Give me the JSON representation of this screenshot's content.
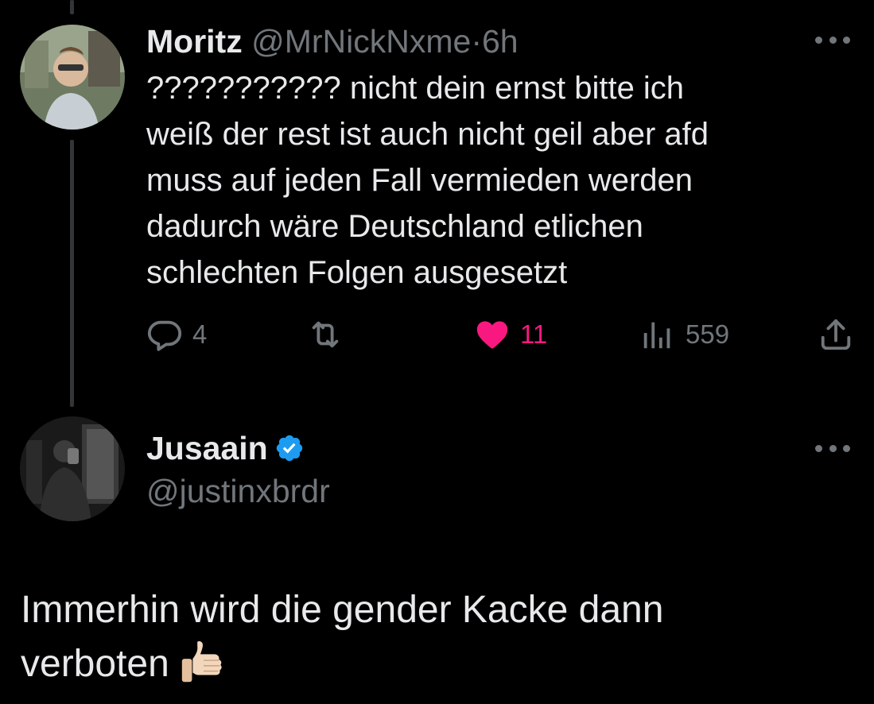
{
  "tweet": {
    "author_name": "Moritz",
    "author_handle": "@MrNickNxme",
    "separator": "·",
    "time": "6h",
    "text_lines": [
      "??????????? nicht dein ernst bitte ich",
      "weiß der rest ist auch nicht geil aber afd",
      "muss auf jeden Fall vermieden werden",
      "dadurch wäre Deutschland etlichen",
      "schlechten Folgen ausgesetzt"
    ],
    "stats": {
      "replies": "4",
      "retweets": "",
      "likes": "11",
      "views": "559"
    },
    "liked": true
  },
  "reply": {
    "author_name": "Jusaain",
    "verified": true,
    "author_handle": "@justinxbrdr",
    "text_lines": [
      "Immerhin wird die gender Kacke dann",
      "verboten"
    ],
    "emoji": "thumbs-up-light-skin-tone"
  },
  "icons": {
    "reply": "reply-icon",
    "retweet": "retweet-icon",
    "like": "heart-icon",
    "views": "views-icon",
    "share": "share-icon",
    "more": "more-icon",
    "verified": "verified-badge-icon"
  },
  "colors": {
    "background": "#000000",
    "text": "#e7e9ea",
    "muted": "#71767b",
    "like": "#f91880",
    "verified": "#1d9bf0",
    "thread_line": "#333639"
  }
}
